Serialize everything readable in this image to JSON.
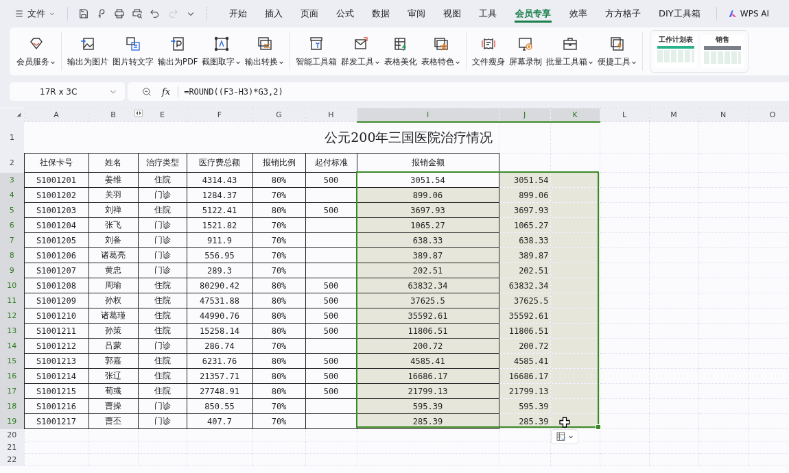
{
  "menu_bar": {
    "file_menu": "文件",
    "tabs": [
      {
        "label": "开始",
        "selected": false
      },
      {
        "label": "插入",
        "selected": false
      },
      {
        "label": "页面",
        "selected": false
      },
      {
        "label": "公式",
        "selected": false
      },
      {
        "label": "数据",
        "selected": false
      },
      {
        "label": "审阅",
        "selected": false
      },
      {
        "label": "视图",
        "selected": false
      },
      {
        "label": "工具",
        "selected": false
      },
      {
        "label": "会员专享",
        "selected": true
      },
      {
        "label": "效率",
        "selected": false
      },
      {
        "label": "方方格子",
        "selected": false
      },
      {
        "label": "DIY工具箱",
        "selected": false
      }
    ],
    "ai_button": "WPS AI"
  },
  "ribbon": {
    "groups": [
      [
        {
          "label": "会员服务",
          "dropdown": true
        }
      ],
      [
        {
          "label": "输出为图片",
          "dropdown": false
        },
        {
          "label": "图片转文字",
          "dropdown": false
        },
        {
          "label": "输出为PDF",
          "dropdown": false
        },
        {
          "label": "截图取字",
          "dropdown": true
        },
        {
          "label": "输出转换",
          "dropdown": true
        }
      ],
      [
        {
          "label": "智能工具箱",
          "dropdown": false
        },
        {
          "label": "群发工具",
          "dropdown": true
        },
        {
          "label": "表格美化",
          "dropdown": false
        },
        {
          "label": "表格特色",
          "dropdown": true
        }
      ],
      [
        {
          "label": "文件瘦身",
          "dropdown": false
        },
        {
          "label": "屏幕录制",
          "dropdown": false
        },
        {
          "label": "批量工具箱",
          "dropdown": true
        },
        {
          "label": "便捷工具",
          "dropdown": true
        }
      ]
    ],
    "templates": [
      {
        "label": "工作计划表"
      },
      {
        "label": "销售"
      }
    ]
  },
  "formula_bar": {
    "name_box": "17R x 3C",
    "function_label": "fx",
    "formula": "=ROUND((F3-H3)*G3,2)"
  },
  "sheet": {
    "columns": [
      {
        "label": "A",
        "selected": false
      },
      {
        "label": "B",
        "selected": false
      },
      {
        "label": "E",
        "selected": false
      },
      {
        "label": "F",
        "selected": false
      },
      {
        "label": "G",
        "selected": false
      },
      {
        "label": "H",
        "selected": false
      },
      {
        "label": "I",
        "selected": true
      },
      {
        "label": "J",
        "selected": true
      },
      {
        "label": "K",
        "selected": true
      },
      {
        "label": "L",
        "selected": false
      },
      {
        "label": "M",
        "selected": false
      },
      {
        "label": "N",
        "selected": false
      },
      {
        "label": "O",
        "selected": false
      }
    ],
    "rows": [
      {
        "number": "1",
        "kind": "title",
        "selected": false,
        "title": "公元200年三国医院治疗情况"
      },
      {
        "number": "2",
        "kind": "header",
        "selected": false,
        "cells": [
          "社保卡号",
          "姓名",
          "治疗类型",
          "医疗费总额",
          "报销比例",
          "起付标准",
          "报销金额"
        ]
      },
      {
        "number": "3",
        "kind": "data",
        "selected": true,
        "active": true,
        "card_no": "S1001201",
        "name": "姜维",
        "type": "住院",
        "total": "4314.43",
        "ratio": "80%",
        "threshold": "500",
        "reimbursed": "3051.54",
        "column_j": "3051.54"
      },
      {
        "number": "4",
        "kind": "data",
        "selected": true,
        "active": false,
        "card_no": "S1001202",
        "name": "关羽",
        "type": "门诊",
        "total": "1284.37",
        "ratio": "70%",
        "reimbursed": "899.06",
        "column_j": "899.06"
      },
      {
        "number": "5",
        "kind": "data",
        "selected": true,
        "active": false,
        "card_no": "S1001203",
        "name": "刘禅",
        "type": "住院",
        "total": "5122.41",
        "ratio": "80%",
        "threshold": "500",
        "reimbursed": "3697.93",
        "column_j": "3697.93"
      },
      {
        "number": "6",
        "kind": "data",
        "selected": true,
        "active": false,
        "card_no": "S1001204",
        "name": "张飞",
        "type": "门诊",
        "total": "1521.82",
        "ratio": "70%",
        "reimbursed": "1065.27",
        "column_j": "1065.27"
      },
      {
        "number": "7",
        "kind": "data",
        "selected": true,
        "active": false,
        "card_no": "S1001205",
        "name": "刘备",
        "type": "门诊",
        "total": "911.9",
        "ratio": "70%",
        "reimbursed": "638.33",
        "column_j": "638.33"
      },
      {
        "number": "8",
        "kind": "data",
        "selected": true,
        "active": false,
        "card_no": "S1001206",
        "name": "诸葛亮",
        "type": "门诊",
        "total": "556.95",
        "ratio": "70%",
        "reimbursed": "389.87",
        "column_j": "389.87"
      },
      {
        "number": "9",
        "kind": "data",
        "selected": true,
        "active": false,
        "card_no": "S1001207",
        "name": "黄忠",
        "type": "门诊",
        "total": "289.3",
        "ratio": "70%",
        "reimbursed": "202.51",
        "column_j": "202.51"
      },
      {
        "number": "10",
        "kind": "data",
        "selected": true,
        "active": false,
        "card_no": "S1001208",
        "name": "周瑜",
        "type": "住院",
        "total": "80290.42",
        "ratio": "80%",
        "threshold": "500",
        "reimbursed": "63832.34",
        "column_j": "63832.34"
      },
      {
        "number": "11",
        "kind": "data",
        "selected": true,
        "active": false,
        "card_no": "S1001209",
        "name": "孙权",
        "type": "住院",
        "total": "47531.88",
        "ratio": "80%",
        "threshold": "500",
        "reimbursed": "37625.5",
        "column_j": "37625.5"
      },
      {
        "number": "12",
        "kind": "data",
        "selected": true,
        "active": false,
        "card_no": "S1001210",
        "name": "诸葛瑾",
        "type": "住院",
        "total": "44990.76",
        "ratio": "80%",
        "threshold": "500",
        "reimbursed": "35592.61",
        "column_j": "35592.61"
      },
      {
        "number": "13",
        "kind": "data",
        "selected": true,
        "active": false,
        "card_no": "S1001211",
        "name": "孙策",
        "type": "住院",
        "total": "15258.14",
        "ratio": "80%",
        "threshold": "500",
        "reimbursed": "11806.51",
        "column_j": "11806.51"
      },
      {
        "number": "14",
        "kind": "data",
        "selected": true,
        "active": false,
        "card_no": "S1001212",
        "name": "吕蒙",
        "type": "门诊",
        "total": "286.74",
        "ratio": "70%",
        "reimbursed": "200.72",
        "column_j": "200.72"
      },
      {
        "number": "15",
        "kind": "data",
        "selected": true,
        "active": false,
        "card_no": "S1001213",
        "name": "郭嘉",
        "type": "住院",
        "total": "6231.76",
        "ratio": "80%",
        "threshold": "500",
        "reimbursed": "4585.41",
        "column_j": "4585.41"
      },
      {
        "number": "16",
        "kind": "data",
        "selected": true,
        "active": false,
        "card_no": "S1001214",
        "name": "张辽",
        "type": "住院",
        "total": "21357.71",
        "ratio": "80%",
        "threshold": "500",
        "reimbursed": "16686.17",
        "column_j": "16686.17"
      },
      {
        "number": "17",
        "kind": "data",
        "selected": true,
        "active": false,
        "card_no": "S1001215",
        "name": "荀彧",
        "type": "住院",
        "total": "27748.91",
        "ratio": "80%",
        "threshold": "500",
        "reimbursed": "21799.13",
        "column_j": "21799.13"
      },
      {
        "number": "18",
        "kind": "data",
        "selected": true,
        "active": false,
        "card_no": "S1001216",
        "name": "曹操",
        "type": "门诊",
        "total": "850.55",
        "ratio": "70%",
        "reimbursed": "595.39",
        "column_j": "595.39"
      },
      {
        "number": "19",
        "kind": "data",
        "selected": true,
        "active": false,
        "card_no": "S1001217",
        "name": "曹丕",
        "type": "门诊",
        "total": "407.7",
        "ratio": "70%",
        "reimbursed": "285.39",
        "column_j": "285.39"
      },
      {
        "number": "20",
        "kind": "empty",
        "selected": false
      },
      {
        "number": "21",
        "kind": "empty",
        "selected": false
      },
      {
        "number": "22",
        "kind": "empty",
        "selected": false
      }
    ]
  }
}
